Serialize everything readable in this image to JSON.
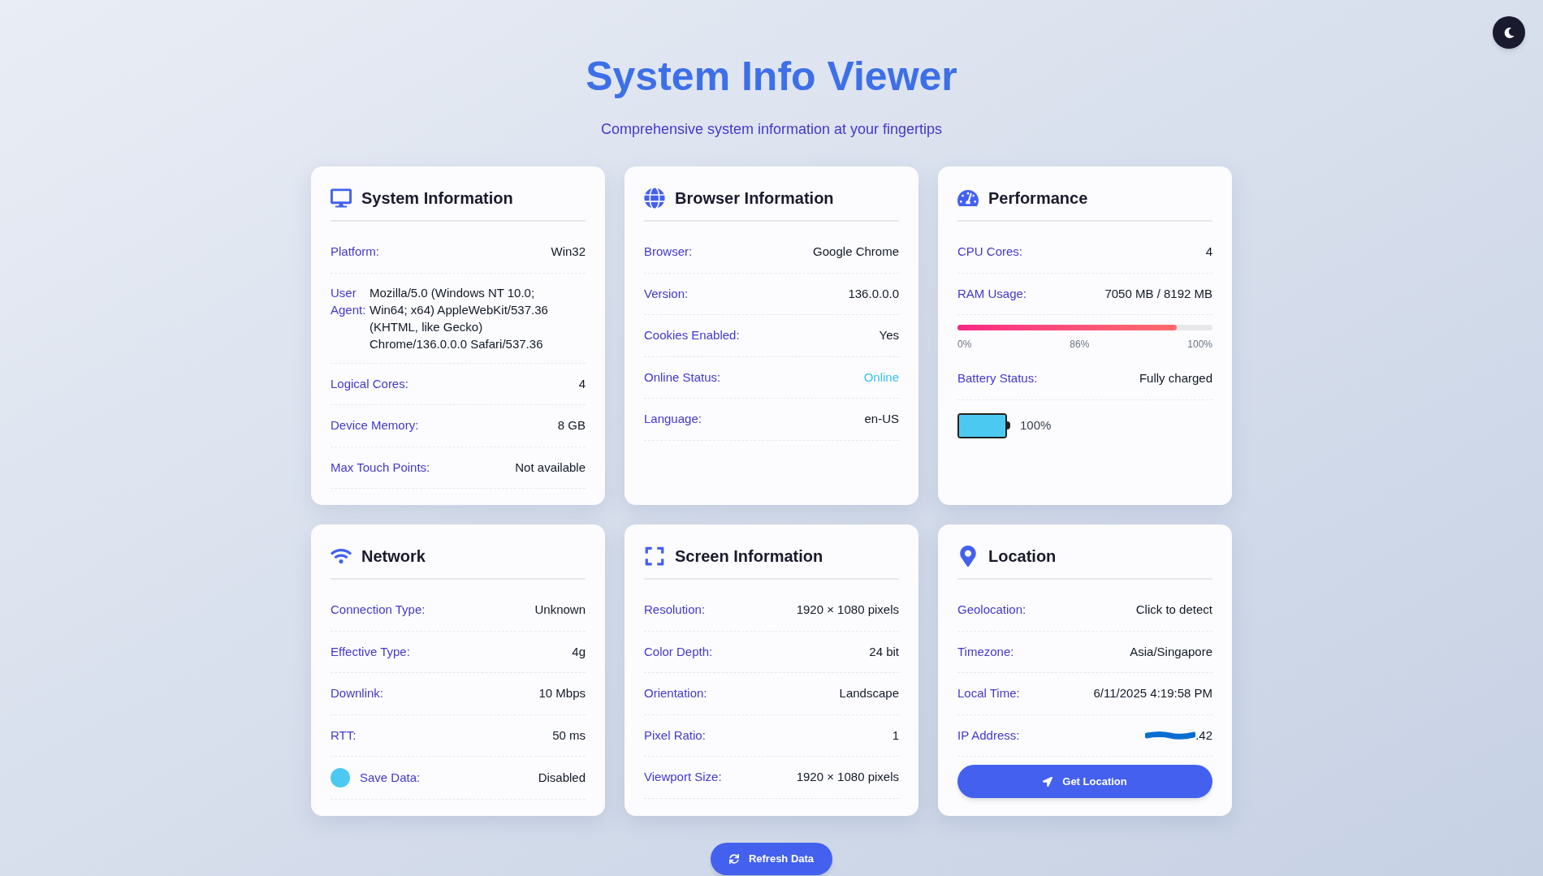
{
  "theme_toggle": {
    "dark": false
  },
  "title": "System Info Viewer",
  "subtitle": "Comprehensive system information at your fingertips",
  "cards": [
    {
      "kind": "system",
      "title": "System Information",
      "items": [
        {
          "kind": "row",
          "label": "Platform:",
          "value": "Win32"
        },
        {
          "kind": "wrap",
          "label": "User Agent:",
          "value": "Mozilla/5.0 (Windows NT 10.0; Win64; x64) AppleWebKit/537.36 (KHTML, like Gecko) Chrome/136.0.0.0 Safari/537.36"
        },
        {
          "kind": "row",
          "label": "Logical Cores:",
          "value": "4"
        },
        {
          "kind": "row",
          "label": "Device Memory:",
          "value": "8 GB"
        },
        {
          "kind": "row",
          "label": "Max Touch Points:",
          "value": "Not available"
        }
      ]
    },
    {
      "kind": "browser",
      "title": "Browser Information",
      "items": [
        {
          "kind": "row",
          "label": "Browser:",
          "value": "Google Chrome"
        },
        {
          "kind": "row",
          "label": "Version:",
          "value": "136.0.0.0"
        },
        {
          "kind": "row",
          "label": "Cookies Enabled:",
          "value": "Yes"
        },
        {
          "kind": "row",
          "label": "Online Status:",
          "value": "Online",
          "color": "#38bdf8"
        },
        {
          "kind": "row",
          "label": "Language:",
          "value": "en-US"
        }
      ]
    },
    {
      "kind": "performance",
      "title": "Performance",
      "items": [
        {
          "kind": "row",
          "label": "CPU Cores:",
          "value": "4"
        },
        {
          "kind": "row",
          "label": "RAM Usage:",
          "value": "7050 MB / 8192 MB"
        },
        {
          "kind": "progress",
          "level": 0.86,
          "min_label": "0%",
          "mid_label": "86%",
          "max_label": "100%"
        },
        {
          "kind": "row",
          "label": "Battery Status:",
          "value": "Fully charged"
        },
        {
          "kind": "battery",
          "level": 1.0,
          "reading": "100%"
        }
      ]
    },
    {
      "kind": "network",
      "title": "Network",
      "items": [
        {
          "kind": "row",
          "label": "Connection Type:",
          "value": "Unknown"
        },
        {
          "kind": "row",
          "label": "Effective Type:",
          "value": "4g"
        },
        {
          "kind": "row",
          "label": "Downlink:",
          "value": "10 Mbps"
        },
        {
          "kind": "row",
          "label": "RTT:",
          "value": "50 ms"
        },
        {
          "kind": "dot",
          "label": "Save Data:",
          "value": "Disabled",
          "color": "#4cc9f0"
        }
      ]
    },
    {
      "kind": "screen",
      "title": "Screen Information",
      "items": [
        {
          "kind": "row",
          "label": "Resolution:",
          "value": "1920 × 1080 pixels"
        },
        {
          "kind": "row",
          "label": "Color Depth:",
          "value": "24 bit"
        },
        {
          "kind": "row",
          "label": "Orientation:",
          "value": "Landscape"
        },
        {
          "kind": "row",
          "label": "Pixel Ratio:",
          "value": "1"
        },
        {
          "kind": "row",
          "label": "Viewport Size:",
          "value": "1920 × 1080 pixels"
        }
      ]
    },
    {
      "kind": "location",
      "title": "Location",
      "items": [
        {
          "kind": "row",
          "label": "Geolocation:",
          "value": "Click to detect"
        },
        {
          "kind": "row",
          "label": "Timezone:",
          "value": "Asia/Singapore"
        },
        {
          "kind": "row",
          "label": "Local Time:",
          "value": "6/11/2025 4:19:58 PM"
        },
        {
          "kind": "row",
          "label": "IP Address:",
          "value": ".42",
          "redacted": true
        },
        {
          "kind": "button",
          "label": "Get Location"
        }
      ]
    }
  ],
  "refresh_button": "Refresh Data"
}
